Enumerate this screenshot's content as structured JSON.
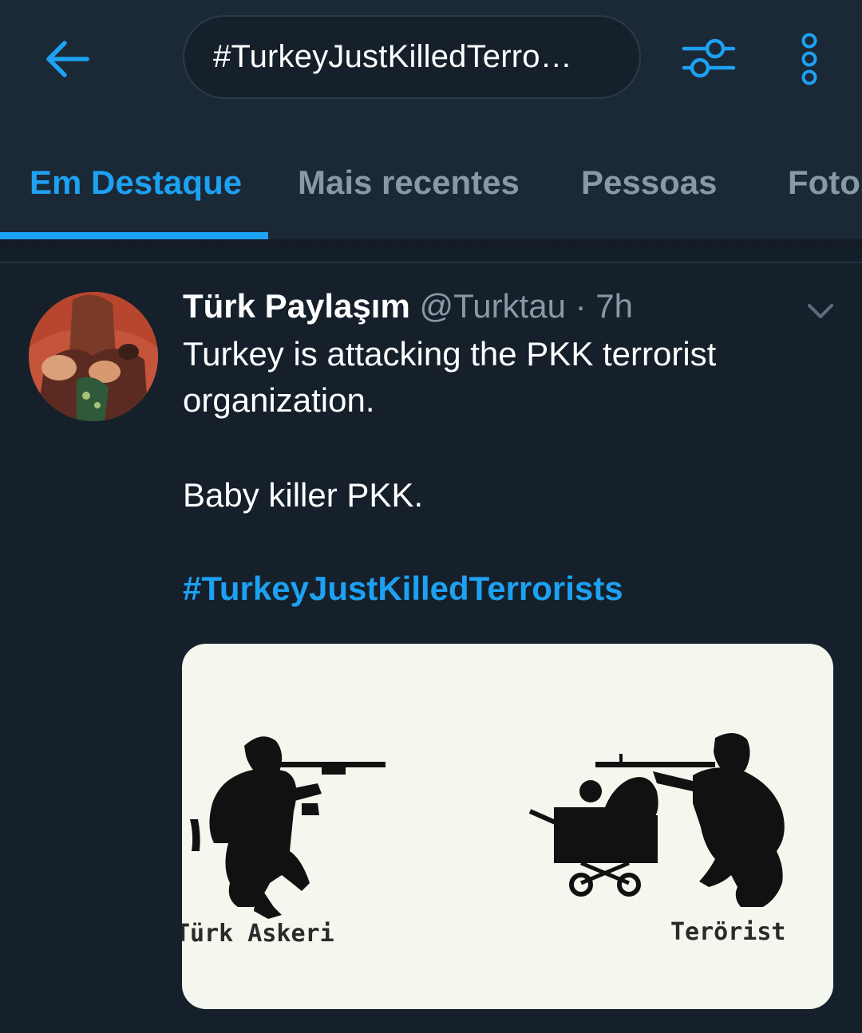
{
  "search": {
    "query": "#TurkeyJustKilledTerro…"
  },
  "tabs": [
    {
      "label": "Em Destaque",
      "active": true
    },
    {
      "label": "Mais recentes",
      "active": false
    },
    {
      "label": "Pessoas",
      "active": false
    },
    {
      "label": "Fotos",
      "active": false
    }
  ],
  "tweet": {
    "display_name": "Türk Paylaşım",
    "handle": "@Turktau",
    "separator": " · ",
    "time": "7h",
    "lines": [
      "Turkey is attacking the PKK terrorist",
      "organization.",
      "Baby killer PKK."
    ],
    "hashtag": "#TurkeyJustKilledTerrorists",
    "media": {
      "caption_left": "Türk Askeri",
      "caption_right": "Terörist"
    }
  },
  "colors": {
    "background": "#15202b",
    "header": "#1b2836",
    "accent": "#1da1f2",
    "muted": "#8899a6"
  }
}
